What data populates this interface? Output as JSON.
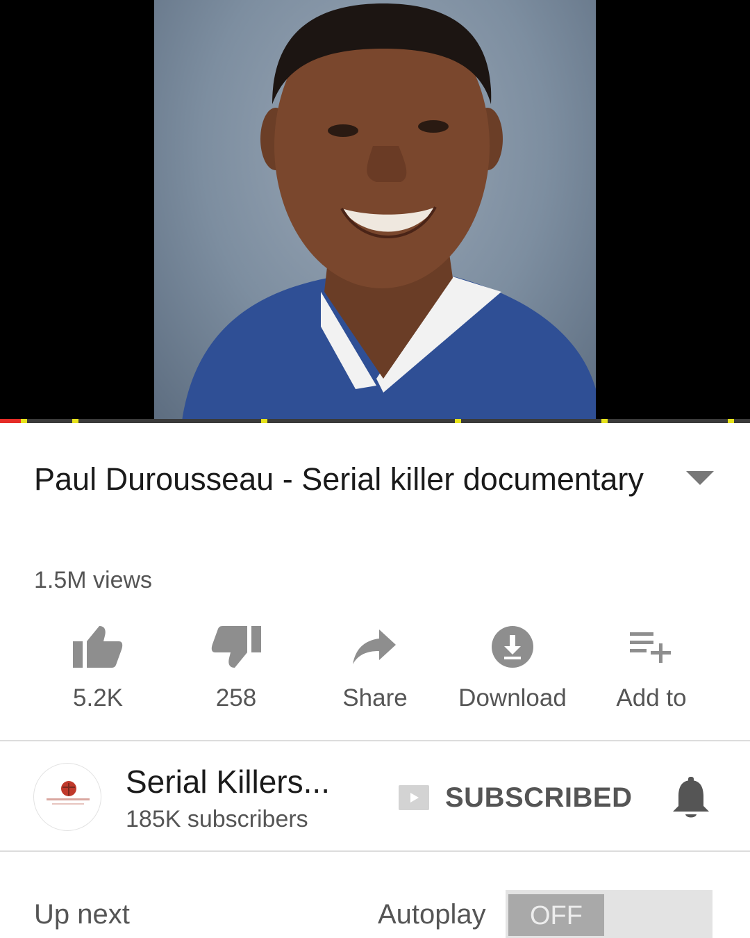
{
  "video": {
    "title": "Paul Durousseau - Serial killer documentary",
    "views": "1.5M views"
  },
  "progress": {
    "played_fraction": 0.03
  },
  "actions": [
    {
      "label": "5.2K",
      "icon": "thumbs-up-icon"
    },
    {
      "label": "258",
      "icon": "thumbs-down-icon"
    },
    {
      "label": "Share",
      "icon": "share-icon"
    },
    {
      "label": "Download",
      "icon": "download-icon"
    },
    {
      "label": "Add to",
      "icon": "add-to-playlist-icon"
    }
  ],
  "channel": {
    "name": "Serial Killers...",
    "subscribers": "185K subscribers",
    "subscribe_state": "SUBSCRIBED"
  },
  "up_next": {
    "label": "Up next",
    "autoplay_label": "Autoplay",
    "autoplay_state": "OFF"
  },
  "colors": {
    "progress_played": "#e52d27",
    "ad_marker": "#e6e21b",
    "icon_gray": "#8e8e8e"
  }
}
